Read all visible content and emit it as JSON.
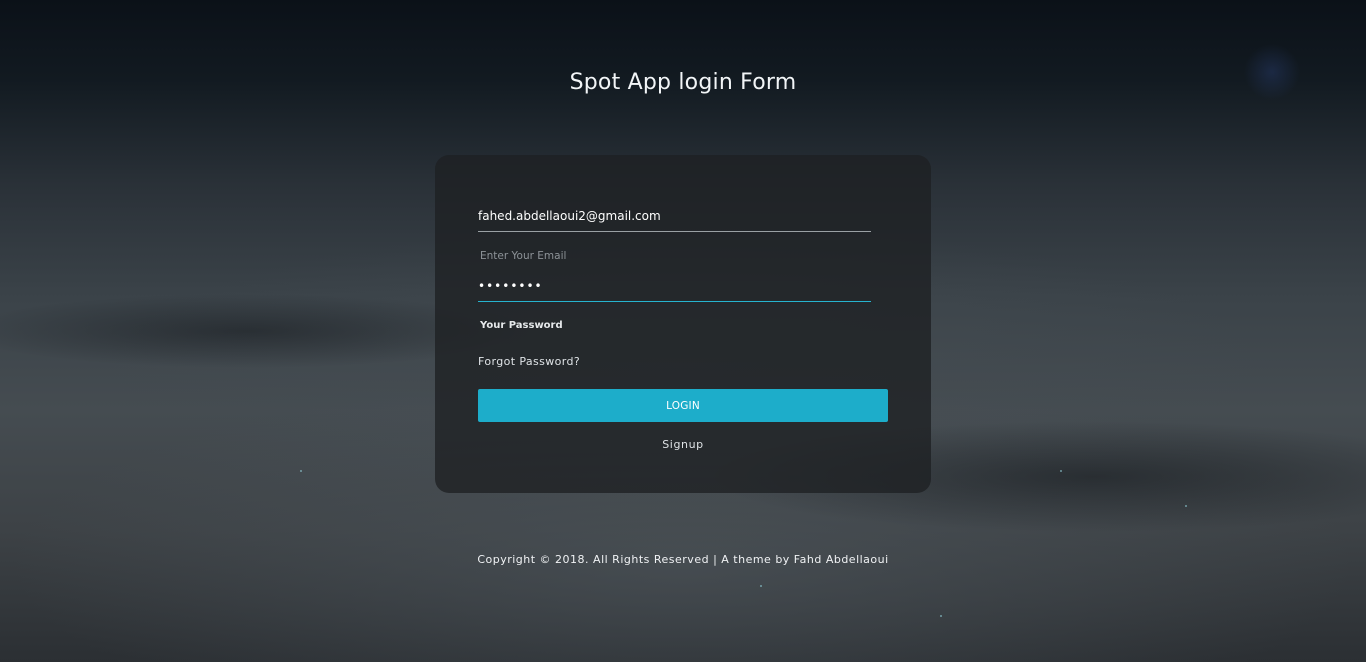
{
  "page": {
    "title": "Spot App login Form"
  },
  "form": {
    "email_value": "fahed.abdellaoui2@gmail.com",
    "email_label": "Enter Your Email",
    "password_value": "••••••••",
    "password_label": "Your Password",
    "forgot_label": "Forgot Password?",
    "login_label": "LOGIN",
    "signup_label": "Signup"
  },
  "footer": {
    "copyright": "Copyright © 2018. All Rights Reserved | A theme by Fahd Abdellaoui"
  },
  "colors": {
    "accent": "#1dadca",
    "card": "#1e2023",
    "text": "#ffffff"
  }
}
